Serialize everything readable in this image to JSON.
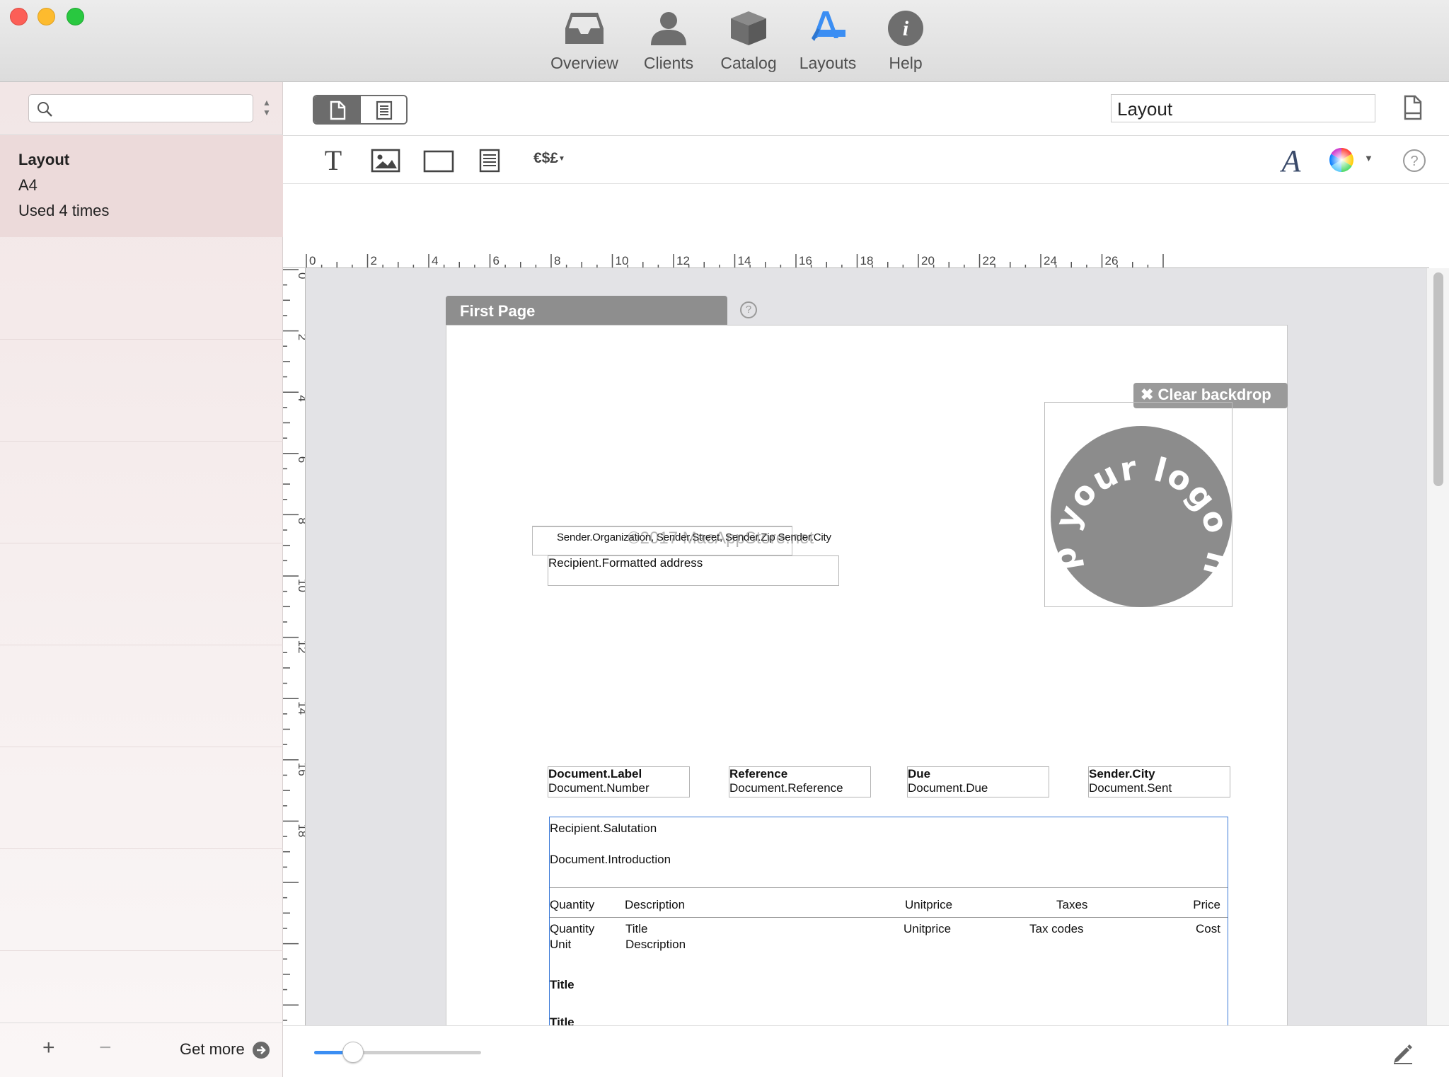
{
  "toolbar": {
    "items": [
      {
        "label": "Overview",
        "icon": "tray-icon"
      },
      {
        "label": "Clients",
        "icon": "person-icon"
      },
      {
        "label": "Catalog",
        "icon": "box-icon"
      },
      {
        "label": "Layouts",
        "icon": "layouts-icon",
        "active": true
      },
      {
        "label": "Help",
        "icon": "info-icon"
      }
    ]
  },
  "sidebar": {
    "search_placeholder": "",
    "selected": {
      "title": "Layout",
      "size": "A4",
      "usage": "Used 4 times"
    },
    "add_symbol": "+",
    "remove_symbol": "−",
    "get_more_label": "Get more"
  },
  "main": {
    "layout_name": "Layout",
    "currency_tool_label": "€$£",
    "ruler_h_labels": [
      "0",
      "2",
      "4",
      "6",
      "8",
      "10",
      "12",
      "14",
      "16",
      "18",
      "20",
      "22",
      "24",
      "26"
    ],
    "ruler_v_labels": [
      "0",
      "2",
      "4",
      "6",
      "8",
      "10",
      "12",
      "14",
      "16",
      "18"
    ]
  },
  "page": {
    "tab_label": "First Page",
    "help_symbol": "?",
    "clear_backdrop_label": "✖ Clear backdrop",
    "logo_text": "Drop your logo here",
    "sender_line": "Sender.Organization, Sender.Street, Sender.Zip Sender.City",
    "watermark": "©2017 MacAppStore.net",
    "recipient": "Recipient.Formatted address",
    "meta_fields": [
      {
        "label": "Document.Label",
        "value": "Document.Number"
      },
      {
        "label": "Reference",
        "value": "Document.Reference"
      },
      {
        "label": "Due",
        "value": "Document.Due"
      },
      {
        "label": "Sender.City",
        "value": "Document.Sent"
      }
    ],
    "salutation": "Recipient.Salutation",
    "introduction": "Document.Introduction",
    "table_header": {
      "quantity": "Quantity",
      "description": "Description",
      "unitprice": "Unitprice",
      "taxes": "Taxes",
      "price": "Price"
    },
    "table_row": {
      "quantity": "Quantity",
      "unit": "Unit",
      "title": "Title",
      "description": "Description",
      "unitprice": "Unitprice",
      "tax_codes": "Tax codes",
      "cost": "Cost"
    },
    "section_title": "Title",
    "section_title_cut": "Title"
  },
  "colors": {
    "accent": "#3b8ef3",
    "sidebar_selected": "#ecdada",
    "tab_gray": "#8e8e8e",
    "logo_gray": "#8c8c8c"
  }
}
